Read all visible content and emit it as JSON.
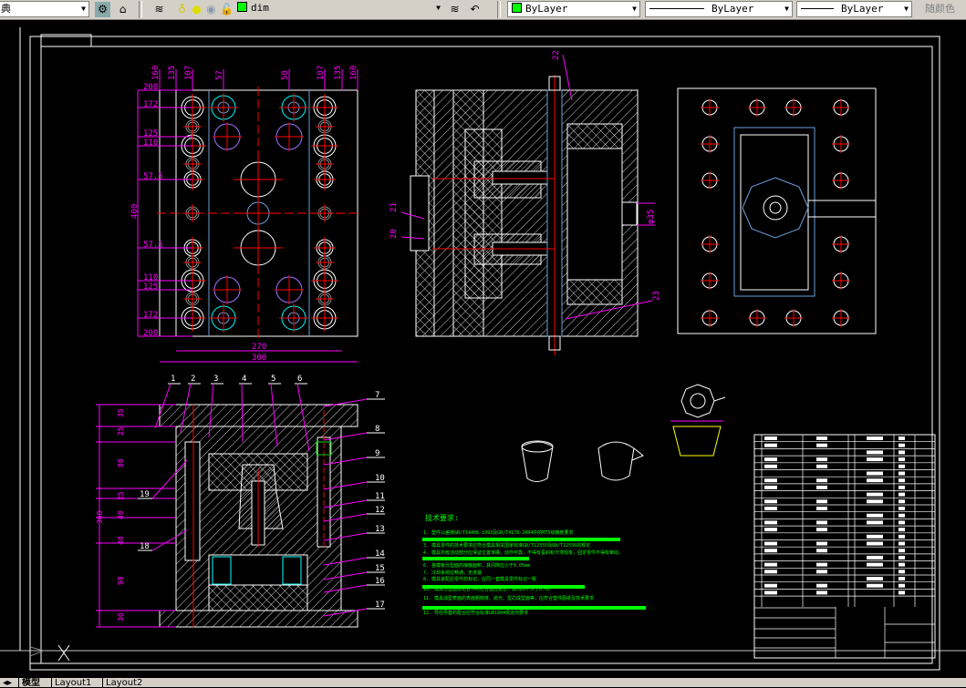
{
  "toolbar": {
    "style_combo_value": "典",
    "layer_name": "dim",
    "color_value": "ByLayer",
    "linetype_value": "ByLayer",
    "lineweight_value": "ByLayer",
    "plotstyle_value": "随颜色",
    "colors": {
      "layer_color": "#00ff00",
      "background": "#d4d0c8"
    }
  },
  "tabs": [
    "模型",
    "Layout1",
    "Layout2"
  ],
  "ucs": {
    "x_label": "X"
  },
  "plan_view": {
    "top_dims": [
      "160",
      "135",
      "107",
      "57",
      "50",
      "107",
      "135",
      "160"
    ],
    "left_dims": [
      "200",
      "172",
      "125",
      "110",
      "57.5",
      "57.5",
      "110",
      "125",
      "172",
      "200"
    ],
    "height_dim": "400",
    "bottom_dims": [
      "270",
      "300"
    ]
  },
  "section_top": {
    "part_labels": [
      "22",
      "21",
      "20",
      "23"
    ],
    "dia_label": "φ35"
  },
  "section_bottom": {
    "part_labels_top": [
      "1",
      "2",
      "3",
      "4",
      "5",
      "6"
    ],
    "part_labels_right": [
      "7",
      "8",
      "9",
      "10",
      "11",
      "12",
      "13",
      "14",
      "15",
      "16",
      "17"
    ],
    "part_labels_left": [
      "19",
      "18"
    ],
    "left_dims": [
      "35",
      "25",
      "80",
      "25",
      "40",
      "40",
      "90",
      "30"
    ],
    "total_height": "360"
  },
  "tech_requirements": {
    "heading": "技术要求:",
    "lines": [
      "1. 塑件公差按GB/T14486-1993及GB/T4170-2004中的MT5级精度要求",
      "3. 模具零件的技术要求应符合模具相关国家标准GB/T12555及GB/T12556的规定",
      "4. 模具所有活动部分应保证位置准确，动作可靠，不得有歪斜和卡滞现象，固定零件不得有窜动。",
      "6. 各模板分型面的接触面积，其间隙应小于0.05mm",
      "7. 冷却系统应畅通，无渗漏",
      "8. 模具装配后零件的标记，应同一套模具零件标记一致",
      "10. 模具分型面及组合件的结合面应贴合，其间隙不大于0.02",
      "11. 模具成型表面的表面粗糙度、抛光、型芯成型面等，应符合塑件图纸及技术要求",
      "12. 导柱导套的配合应符合标准GB1804规定的要求"
    ],
    "colors": {
      "text": "#00ff00",
      "bars": "#00ff00"
    }
  },
  "colors": {
    "canvas": "#000000",
    "lines": "#ffffff",
    "dimension": "#ff00ff",
    "centerline": "#ff0000",
    "cyan": "#00ffff",
    "blue": "#6d9ed9"
  }
}
